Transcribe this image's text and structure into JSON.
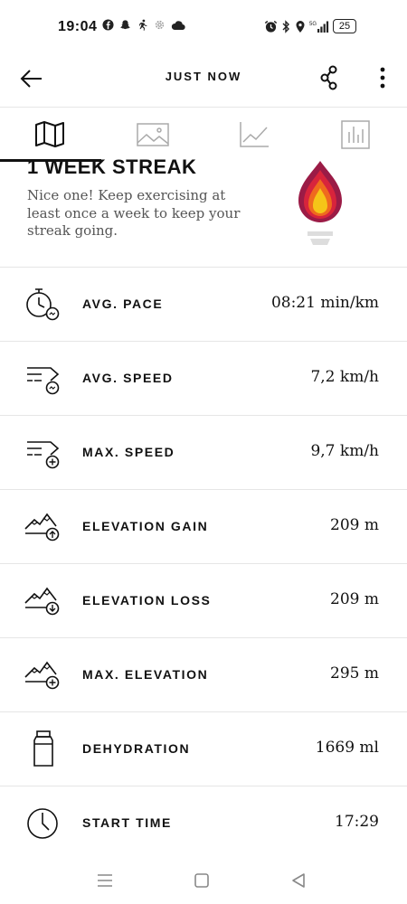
{
  "status_bar": {
    "time": "19:04",
    "battery": "25"
  },
  "app_bar": {
    "title": "JUST NOW"
  },
  "tabs": [
    {
      "name": "map",
      "icon": "map-icon"
    },
    {
      "name": "photos",
      "icon": "image-icon"
    },
    {
      "name": "graphs",
      "icon": "line-chart-icon"
    },
    {
      "name": "laps",
      "icon": "bar-chart-icon"
    }
  ],
  "streak": {
    "title": "1 WEEK STREAK",
    "text": "Nice one! Keep exercising at least once a week to keep your streak going."
  },
  "metrics": [
    {
      "label": "AVG. PACE",
      "value": "08:21 min/km",
      "icon": "stopwatch-icon"
    },
    {
      "label": "AVG. SPEED",
      "value": "7,2 km/h",
      "icon": "speed-icon"
    },
    {
      "label": "MAX. SPEED",
      "value": "9,7 km/h",
      "icon": "max-speed-icon"
    },
    {
      "label": "ELEVATION GAIN",
      "value": "209 m",
      "icon": "elevation-gain-icon"
    },
    {
      "label": "ELEVATION LOSS",
      "value": "209 m",
      "icon": "elevation-loss-icon"
    },
    {
      "label": "MAX. ELEVATION",
      "value": "295 m",
      "icon": "max-elevation-icon"
    },
    {
      "label": "DEHYDRATION",
      "value": "1669 ml",
      "icon": "bottle-icon"
    },
    {
      "label": "START TIME",
      "value": "17:29",
      "icon": "clock-icon"
    }
  ],
  "colors": {
    "text": "#111111",
    "divider": "#e6e6e6",
    "muted": "#555555",
    "flame_outer": "#9b1b46",
    "flame_mid": "#e8432a",
    "flame_inner": "#f5c518"
  }
}
